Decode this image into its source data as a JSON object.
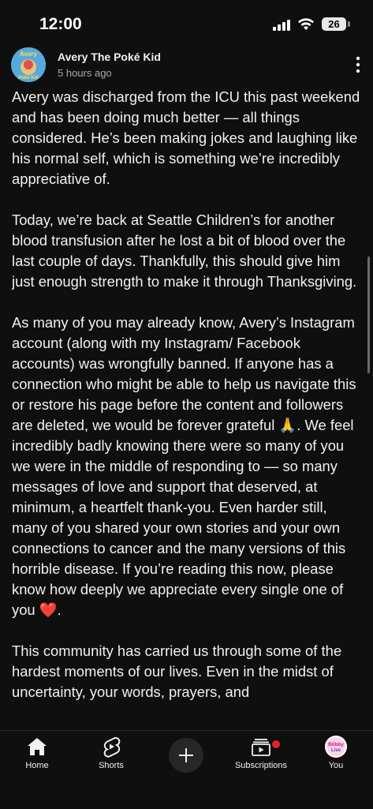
{
  "status_bar": {
    "time": "12:00",
    "battery": "26"
  },
  "post": {
    "author": "Avery The Poké Kid",
    "timestamp": "5 hours ago",
    "avatar_text_top": "Avery",
    "avatar_text_bottom": "Poké Kid",
    "paragraphs": [
      "Avery was discharged from the ICU this past weekend and has been doing much better — all things considered. He’s been making jokes and laughing like his normal self, which is something we’re incredibly appreciative of.",
      "Today, we’re back at Seattle Children’s for another blood transfusion after he lost a bit of blood over the last couple of days. Thankfully, this should give him just enough strength to make it through Thanksgiving.",
      "As many of you may already know, Avery’s Instagram account (along with my Instagram/ Facebook accounts) was wrongfully banned. If anyone has a connection who might be able to help us navigate this or restore his page before the content and followers are deleted, we would be forever grateful 🙏. We feel incredibly badly knowing there were so many of you we were in the middle of responding to — so many messages of love and support that deserved, at minimum, a heartfelt thank-you. Even harder still, many of you shared your own stories and your own connections to cancer and the many versions of this horrible disease. If you’re reading this now, please know how deeply we appreciate every single one of you ❤️.",
      "This community has carried us through some of the hardest moments of our lives. Even in the midst of uncertainty, your words, prayers, and"
    ]
  },
  "bottom_nav": {
    "home": "Home",
    "shorts": "Shorts",
    "subscriptions": "Subscriptions",
    "you": "You",
    "you_avatar_text": "Blibby Live"
  },
  "icons": {
    "more": "more-vert-icon",
    "home": "home-icon",
    "shorts": "shorts-icon",
    "create": "plus-icon",
    "subscriptions": "subscriptions-icon"
  },
  "colors": {
    "background": "#0f0f0f",
    "text": "#f1f1f1",
    "secondary_text": "#aaaaaa",
    "notification_dot": "#e0242e"
  }
}
